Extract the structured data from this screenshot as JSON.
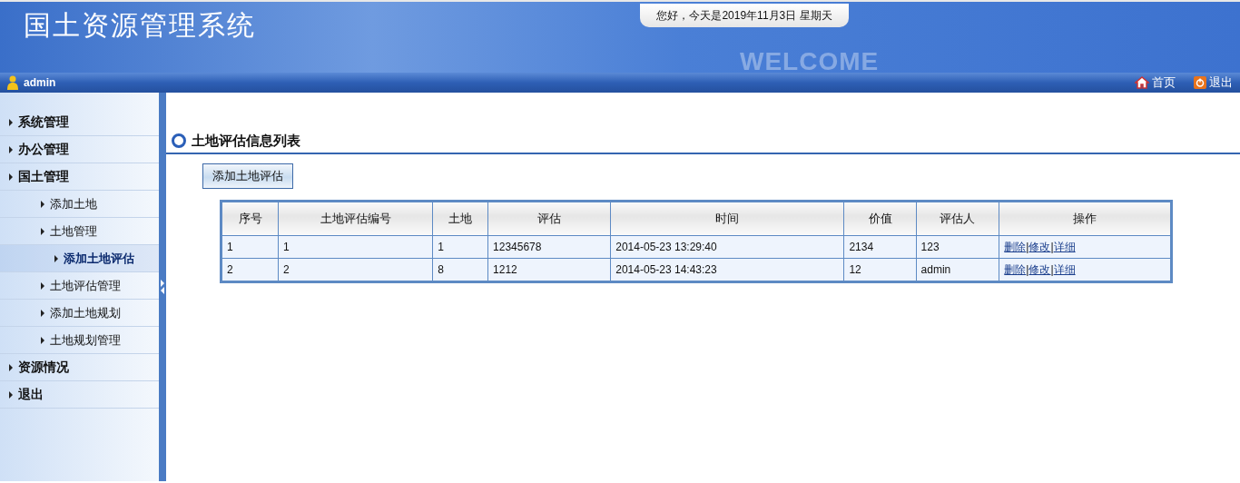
{
  "header": {
    "title": "国土资源管理系统",
    "greeting": "您好，今天是2019年11月3日 星期天",
    "welcome": "WELCOME"
  },
  "topbar": {
    "user": "admin",
    "links": [
      {
        "kind": "home",
        "label": "首页"
      },
      {
        "kind": "logout",
        "label": "退出"
      }
    ]
  },
  "sidebar": {
    "items": [
      {
        "label": "系统管理",
        "selected": false
      },
      {
        "label": "办公管理",
        "selected": false
      },
      {
        "label": "国土管理",
        "selected": false,
        "children": [
          {
            "label": "添加土地",
            "selected": false
          },
          {
            "label": "土地管理",
            "selected": false,
            "children": [
              {
                "label": "添加土地评估",
                "selected": true
              }
            ]
          },
          {
            "label": "土地评估管理",
            "selected": false
          },
          {
            "label": "添加土地规划",
            "selected": false
          },
          {
            "label": "土地规划管理",
            "selected": false
          }
        ]
      },
      {
        "label": "资源情况",
        "selected": false
      },
      {
        "label": "退出",
        "selected": false
      }
    ]
  },
  "page": {
    "title": "土地评估信息列表",
    "add_button": "添加土地评估"
  },
  "table": {
    "columns": [
      "序号",
      "土地评估编号",
      "土地",
      "评估",
      "时间",
      "价值",
      "评估人",
      "操作"
    ],
    "separator": "|",
    "rows": [
      {
        "cells": [
          "1",
          "1",
          "1",
          "12345678",
          "2014-05-23 13:29:40",
          "2134",
          "123"
        ],
        "actions": [
          "删除",
          "修改",
          "详细"
        ]
      },
      {
        "cells": [
          "2",
          "2",
          "8",
          "1212",
          "2014-05-23 14:43:23",
          "12",
          "admin"
        ],
        "actions": [
          "删除",
          "修改",
          "详细"
        ]
      }
    ]
  }
}
